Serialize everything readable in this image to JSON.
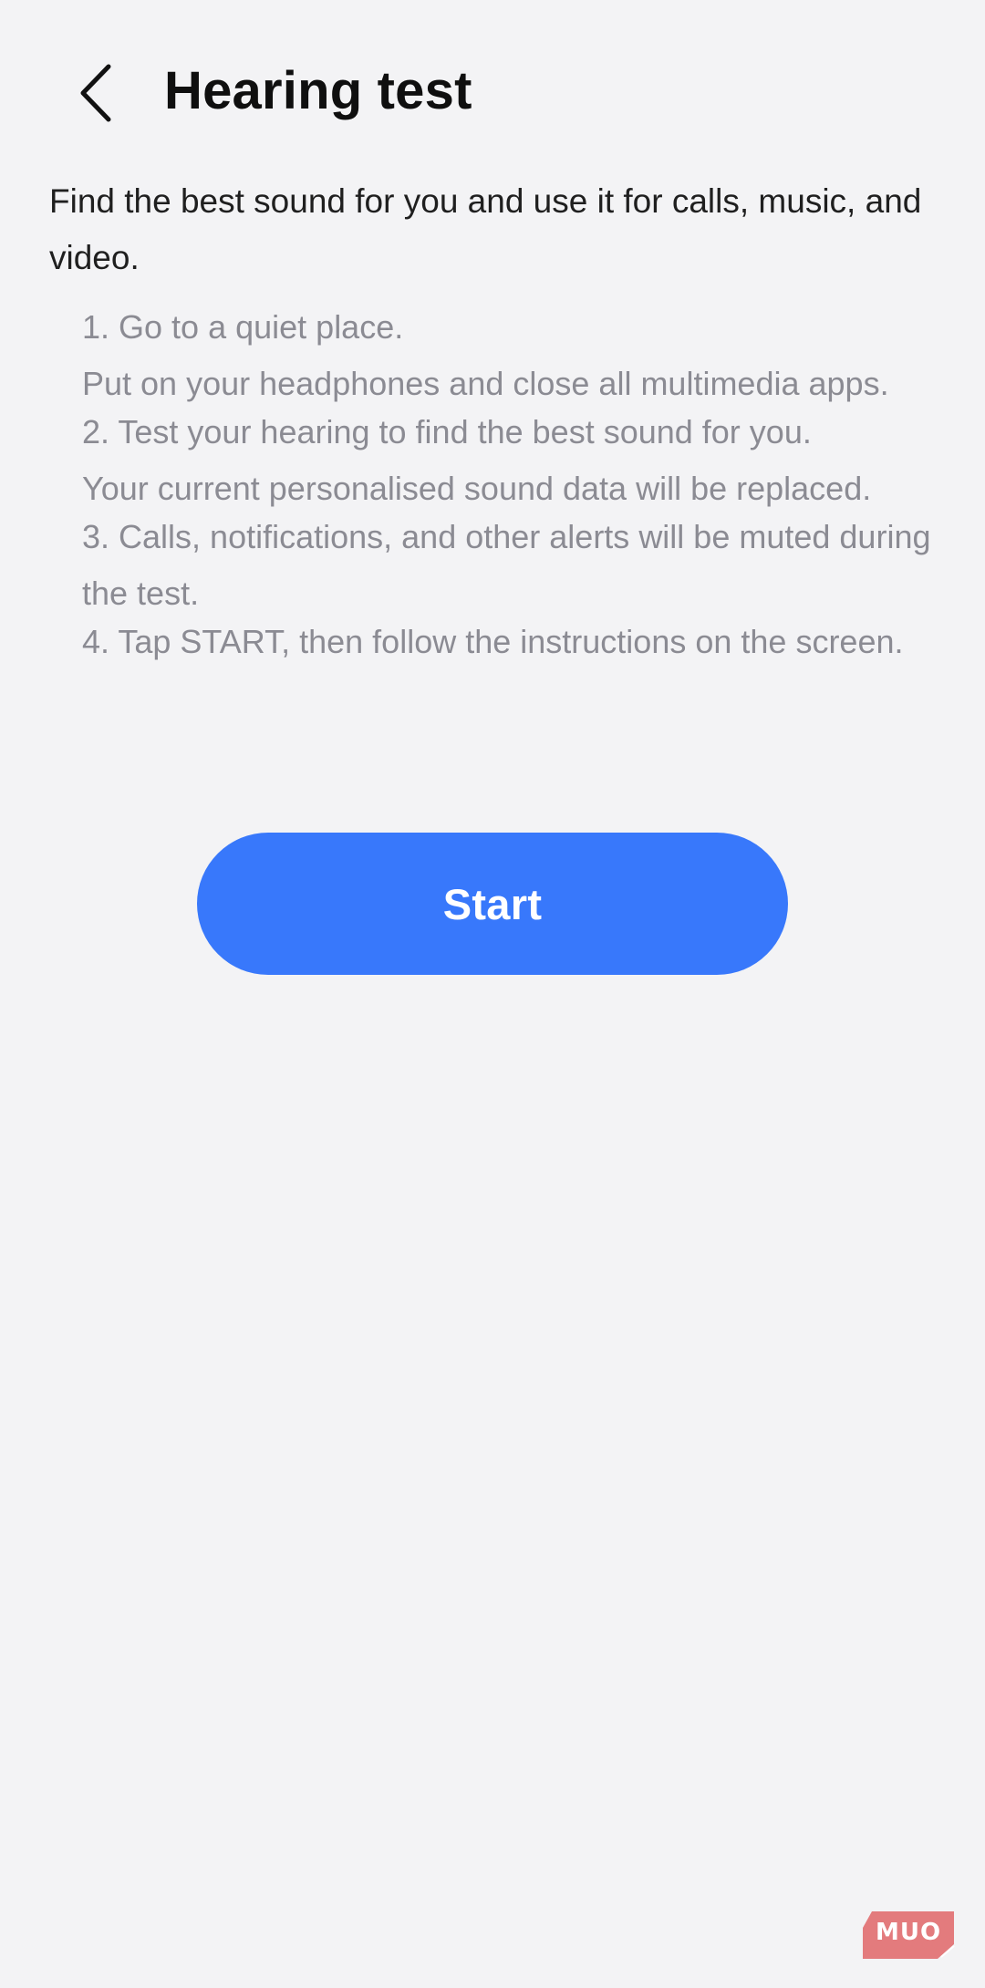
{
  "header": {
    "title": "Hearing test",
    "back_icon": "chevron-left-icon"
  },
  "intro": {
    "text": "Find the best sound for you and use it for calls, music, and video."
  },
  "steps": [
    {
      "lines": [
        "1. Go to a quiet place.",
        "Put on your headphones and close all multimedia apps."
      ]
    },
    {
      "lines": [
        "2. Test your hearing to find the best sound for you.",
        "Your current personalised sound data will be replaced."
      ]
    },
    {
      "lines": [
        "3. Calls, notifications, and other alerts will be muted during the test."
      ]
    },
    {
      "lines": [
        "4. Tap START, then follow the instructions on the screen."
      ]
    }
  ],
  "actions": {
    "start_label": "Start"
  },
  "watermark": {
    "text": "MUO"
  },
  "colors": {
    "background": "#f3f3f5",
    "accent": "#3878fb",
    "title_text": "#0f0f0f",
    "body_text": "#1f1f1f",
    "secondary_text": "#8b8b93",
    "watermark": "#e06a6c"
  }
}
